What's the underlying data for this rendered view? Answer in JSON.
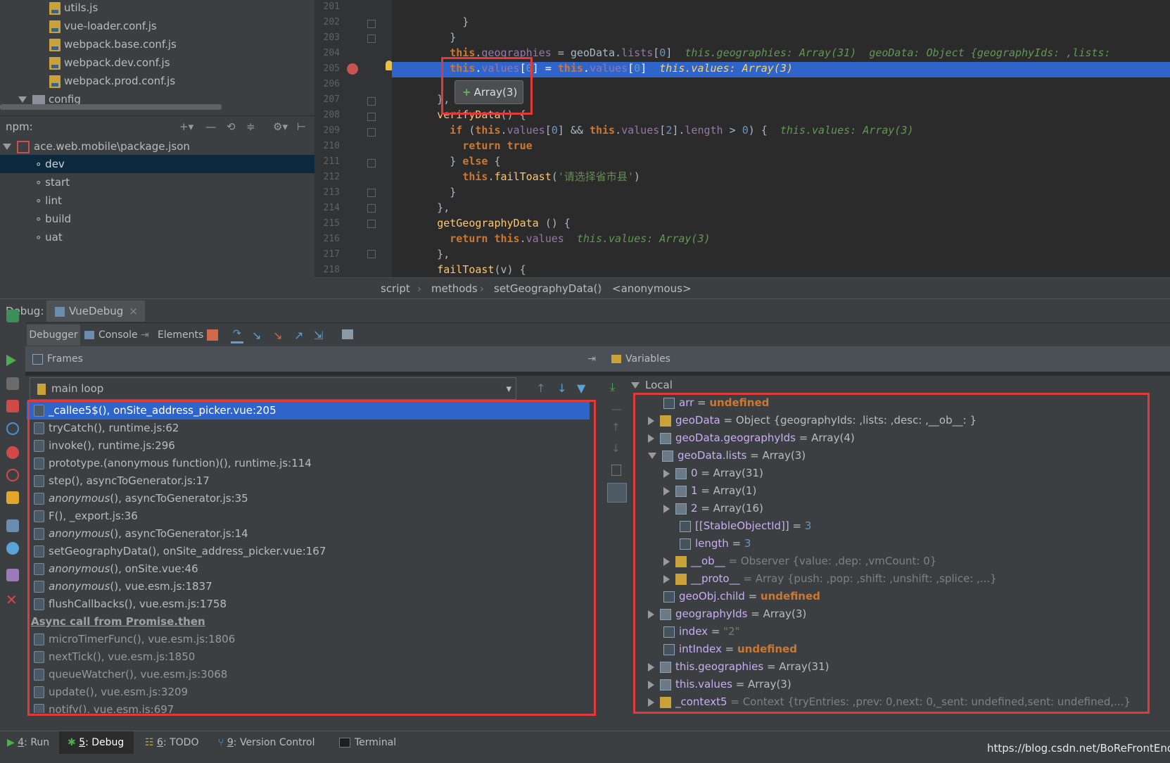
{
  "project": {
    "files": [
      "utils.js",
      "vue-loader.conf.js",
      "webpack.base.conf.js",
      "webpack.dev.conf.js",
      "webpack.prod.conf.js"
    ],
    "folder": "config",
    "npm_label": "npm:",
    "package": "ace.web.mobile\\package.json",
    "scripts": [
      "dev",
      "start",
      "lint",
      "build",
      "uat"
    ]
  },
  "editor": {
    "line_numbers": [
      "201",
      "202",
      "203",
      "204",
      "205",
      "206",
      "207",
      "208",
      "209",
      "210",
      "211",
      "212",
      "213",
      "214",
      "215",
      "216",
      "217",
      "218"
    ],
    "tooltip": "Array(3)",
    "string_literal": "'请选择省市县'",
    "inline_204a": "this.geographies: Array(31)",
    "inline_204b": "geoData: Object {geographyIds: ,lists:",
    "inline_205": "this.values: Array(3)",
    "inline_209": "this.values: Array(3)",
    "inline_216": "this.values: Array(3)"
  },
  "breadcrumb": [
    "script",
    "methods",
    "setGeographyData()",
    "<anonymous>"
  ],
  "debug": {
    "label": "Debug:",
    "config_tab": "VueDebug",
    "tabs": [
      "Debugger",
      "Console",
      "Elements"
    ]
  },
  "frames": {
    "title": "Frames",
    "thread": "main loop",
    "items": [
      "_callee5$(), onSite_address_picker.vue:205",
      "tryCatch(), runtime.js:62",
      "invoke(), runtime.js:296",
      "prototype.(anonymous function)(), runtime.js:114",
      "step(), asyncToGenerator.js:17",
      "anonymous",
      "F(), _export.js:36",
      "anonymous",
      "setGeographyData(), onSite_address_picker.vue:167",
      "anonymous",
      "anonymous",
      "flushCallbacks(), vue.esm.js:1758"
    ],
    "italic_suffix": [
      "",
      "",
      "",
      "",
      "",
      "(), asyncToGenerator.js:35",
      "",
      "(), asyncToGenerator.js:14",
      "",
      "(), onSite.vue:46",
      "(), vue.esm.js:1837",
      ""
    ],
    "async_label": "Async call from Promise.then",
    "async_items": [
      "microTimerFunc(), vue.esm.js:1806",
      "nextTick(), vue.esm.js:1850",
      "queueWatcher(), vue.esm.js:3068",
      "update(), vue.esm.js:3209",
      "notify(), vue.esm.js:697"
    ]
  },
  "variables": {
    "title": "Variables",
    "scope": "Local",
    "rows": [
      {
        "name": "arr",
        "eq": " = ",
        "value": "undefined",
        "kind": "und"
      },
      {
        "name": "geoData",
        "eq": " = ",
        "value": "Object {geographyIds: ,lists: ,desc: ,__ob__: }",
        "kind": "obj"
      },
      {
        "name": "geoData.geographyIds",
        "eq": " = ",
        "value": "Array(4)",
        "kind": "val"
      },
      {
        "name": "geoData.lists",
        "eq": " = ",
        "value": "Array(3)",
        "kind": "val"
      },
      {
        "name": "0",
        "eq": " = ",
        "value": "Array(31)",
        "kind": "val"
      },
      {
        "name": "1",
        "eq": " = ",
        "value": "Array(1)",
        "kind": "val"
      },
      {
        "name": "2",
        "eq": " = ",
        "value": "Array(16)",
        "kind": "val"
      },
      {
        "name": "[[StableObjectId]]",
        "eq": " = ",
        "value": "3",
        "kind": "num"
      },
      {
        "name": "length",
        "eq": " = ",
        "value": "3",
        "kind": "num"
      },
      {
        "name": "__ob__",
        "eq": " = ",
        "value": "Observer {value: ,dep: ,vmCount: 0}",
        "kind": "obj"
      },
      {
        "name": "__proto__",
        "eq": " = ",
        "value": "Array {push: ,pop: ,shift: ,unshift: ,splice: ,...}",
        "kind": "obj"
      },
      {
        "name": "geoObj.child",
        "eq": " = ",
        "value": "undefined",
        "kind": "und"
      },
      {
        "name": "geographyIds",
        "eq": " = ",
        "value": "Array(3)",
        "kind": "val"
      },
      {
        "name": "index",
        "eq": " = ",
        "value": "\"2\"",
        "kind": "str"
      },
      {
        "name": "intIndex",
        "eq": " = ",
        "value": "undefined",
        "kind": "und"
      },
      {
        "name": "this.geographies",
        "eq": " = ",
        "value": "Array(31)",
        "kind": "val"
      },
      {
        "name": "this.values",
        "eq": " = ",
        "value": "Array(3)",
        "kind": "val"
      },
      {
        "name": "_context5",
        "eq": " = ",
        "value": "Context {tryEntries: ,prev: 0,next: 0,_sent: undefined,sent: undefined,...}",
        "kind": "obj"
      }
    ]
  },
  "statusbar": {
    "items": [
      {
        "key": "4",
        "label": ": Run"
      },
      {
        "key": "5",
        "label": ": Debug"
      },
      {
        "key": "6",
        "label": ": TODO"
      },
      {
        "key": "9",
        "label": ": Version Control"
      },
      {
        "key": "",
        "label": "Terminal"
      }
    ],
    "watermark": "https://blog.csdn.net/BoReFrontEnd"
  },
  "colors": {
    "selection": "#2f65ca",
    "highlight_box": "#e03a3a"
  }
}
